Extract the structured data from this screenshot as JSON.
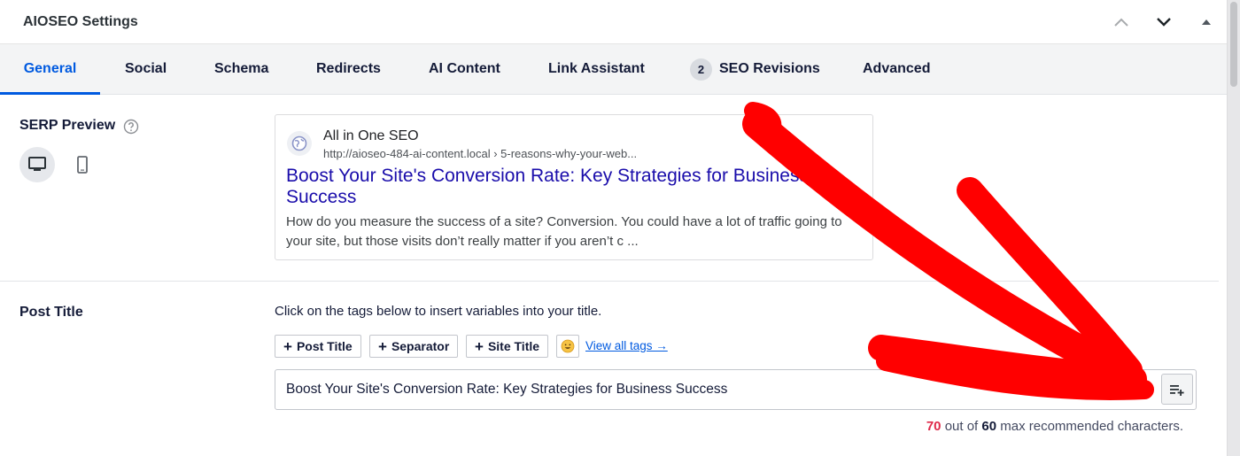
{
  "metabox": {
    "title": "AIOSEO Settings"
  },
  "tabs": [
    {
      "label": "General",
      "active": true
    },
    {
      "label": "Social"
    },
    {
      "label": "Schema"
    },
    {
      "label": "Redirects"
    },
    {
      "label": "AI Content"
    },
    {
      "label": "Link Assistant"
    },
    {
      "label": "SEO Revisions",
      "badge": "2"
    },
    {
      "label": "Advanced"
    }
  ],
  "serp": {
    "label": "SERP Preview",
    "site_name": "All in One SEO",
    "url": "http://aioseo-484-ai-content.local › 5-reasons-why-your-web...",
    "title_line1": "Boost Your Site's Conversion Rate: Key Strategies for Business",
    "title_line2": "Success",
    "description": "How do you measure the success of a site? Conversion. You could have a lot of traffic going to your site, but those visits don’t really matter if you aren’t c ..."
  },
  "post_title": {
    "label": "Post Title",
    "hint": "Click on the tags below to insert variables into your title.",
    "tags": [
      "Post Title",
      "Separator",
      "Site Title"
    ],
    "view_all_tags": "View all tags →",
    "value": "Boost Your Site's Conversion Rate: Key Strategies for Business Success",
    "char_count": "70",
    "char_text_mid": "out of",
    "char_max": "60",
    "char_text_end": "max recommended characters."
  },
  "icons": {
    "help": "help-circle-icon",
    "desktop": "desktop-icon",
    "mobile": "mobile-icon",
    "globe": "globe-icon",
    "emoji": "emoji-icon",
    "insert": "insert-tag-icon"
  },
  "colors": {
    "accent": "#005ae0",
    "serp_title": "#1a0dab",
    "over_limit": "#df2a4a",
    "annotation_arrow": "#ff0000"
  }
}
